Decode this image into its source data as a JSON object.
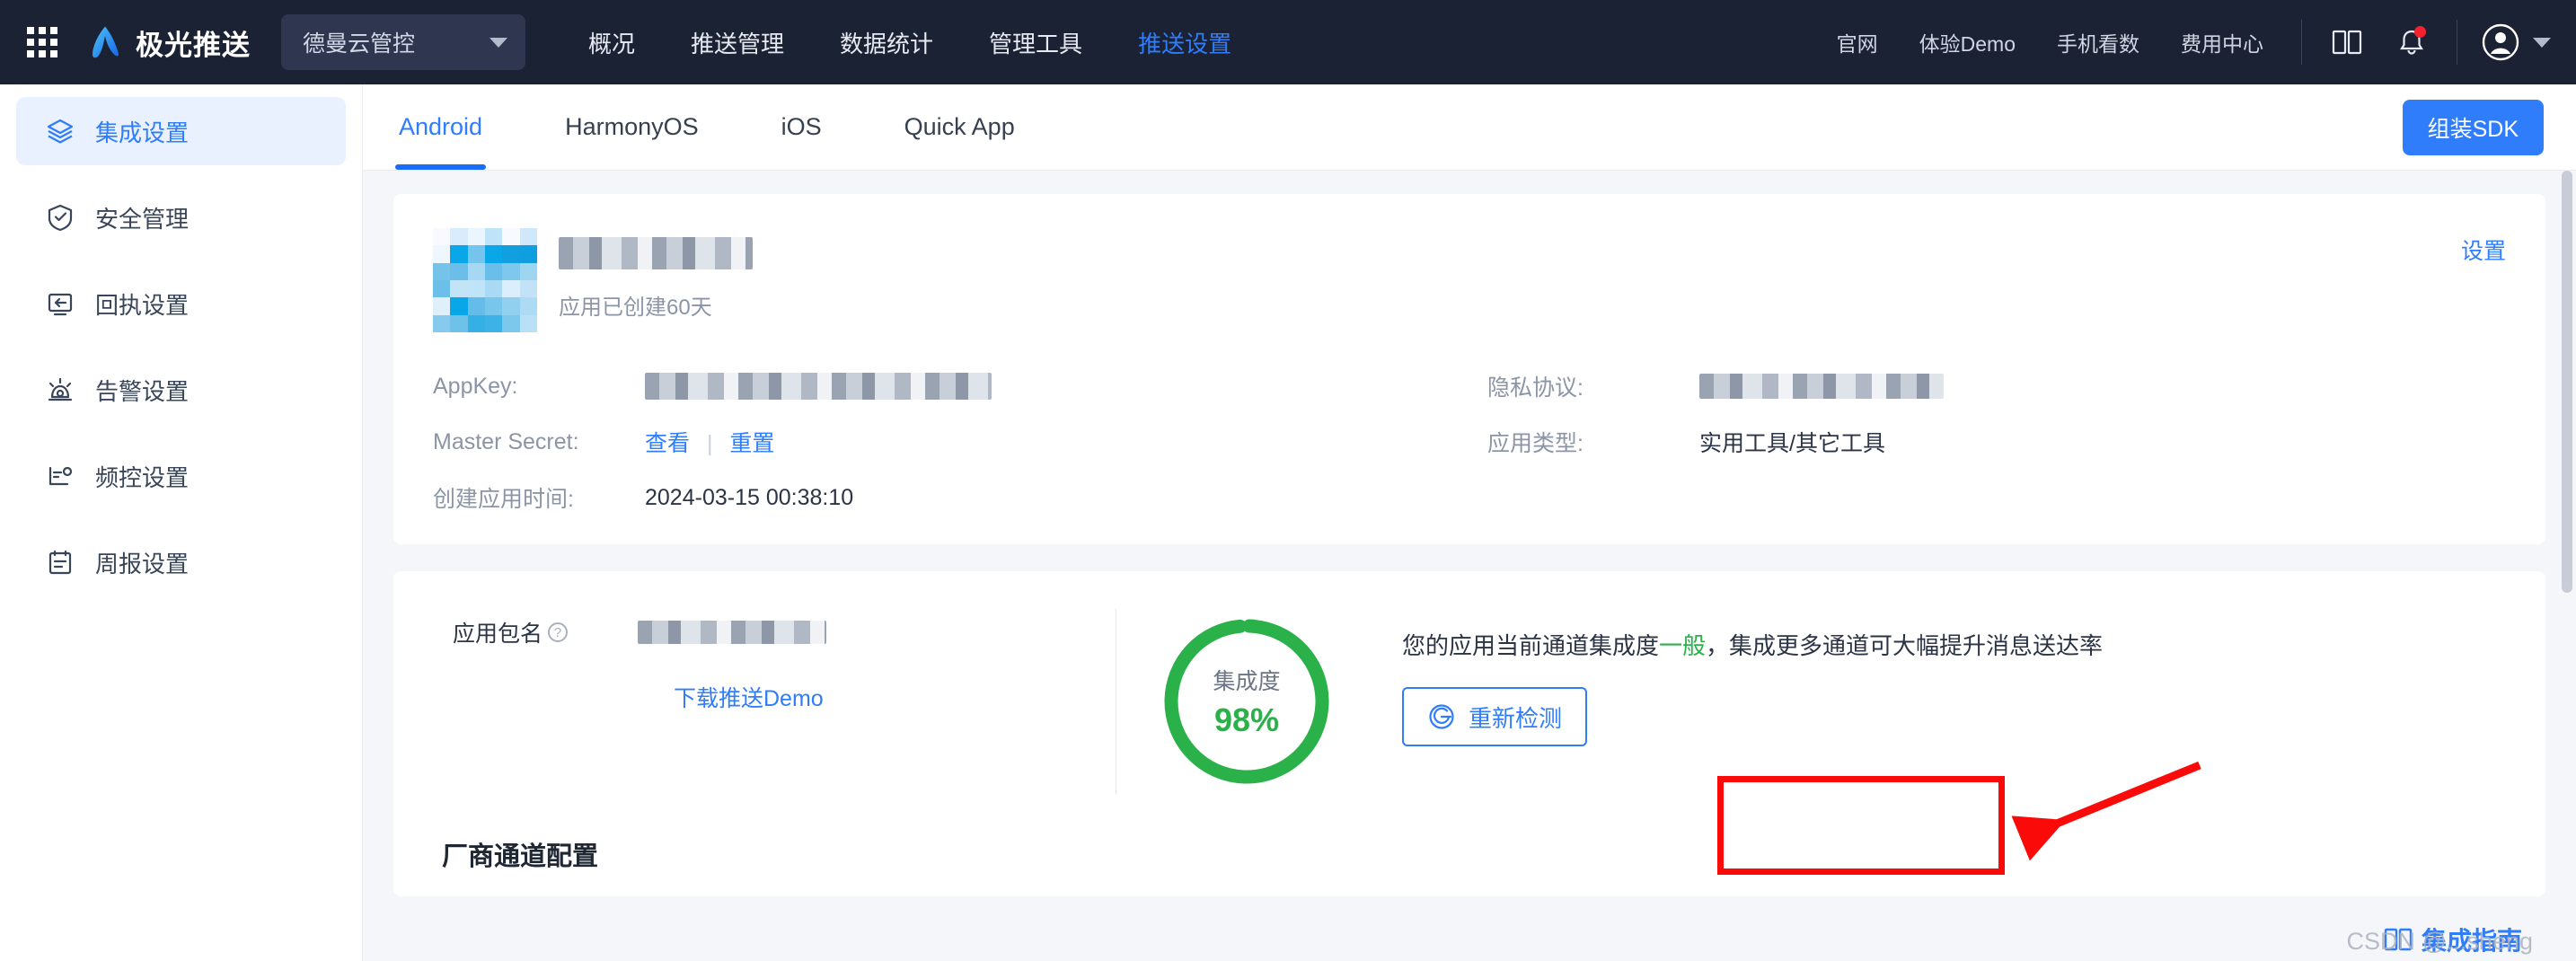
{
  "header": {
    "grid_icon": "apps-grid-icon",
    "brand": "极光推送",
    "app_selector": {
      "value": "德曼云管控",
      "icon": "chevron-down-icon"
    },
    "main_nav": [
      {
        "label": "概况",
        "active": false
      },
      {
        "label": "推送管理",
        "active": false
      },
      {
        "label": "数据统计",
        "active": false
      },
      {
        "label": "管理工具",
        "active": false
      },
      {
        "label": "推送设置",
        "active": true
      }
    ],
    "util_nav": [
      "官网",
      "体验Demo",
      "手机看数",
      "费用中心"
    ],
    "icons": [
      "book-icon",
      "bell-icon",
      "avatar-icon",
      "chevron-down-icon"
    ],
    "notification_badge": true
  },
  "sidebar": {
    "items": [
      {
        "label": "集成设置",
        "icon": "layers-icon",
        "active": true
      },
      {
        "label": "安全管理",
        "icon": "shield-check-icon",
        "active": false
      },
      {
        "label": "回执设置",
        "icon": "receipt-arrow-icon",
        "active": false
      },
      {
        "label": "告警设置",
        "icon": "alarm-icon",
        "active": false
      },
      {
        "label": "频控设置",
        "icon": "frequency-icon",
        "active": false
      },
      {
        "label": "周报设置",
        "icon": "report-icon",
        "active": false
      }
    ]
  },
  "tabs": [
    {
      "label": "Android",
      "active": true
    },
    {
      "label": "HarmonyOS",
      "active": false
    },
    {
      "label": "iOS",
      "active": false
    },
    {
      "label": "Quick App",
      "active": false
    }
  ],
  "toolbar": {
    "sdk_button": "组装SDK"
  },
  "app_card": {
    "app_name": "",
    "app_age": "应用已创建60天",
    "settings_link": "设置",
    "fields": [
      {
        "key": "AppKey:",
        "value": "",
        "masked": true
      },
      {
        "key": "隐私协议:",
        "value": "",
        "masked": true
      },
      {
        "key": "Master Secret:",
        "value": "",
        "links": [
          "查看",
          "重置"
        ]
      },
      {
        "key": "应用类型:",
        "value": "实用工具/其它工具"
      },
      {
        "key": "创建应用时间:",
        "value": "2024-03-15 00:38:10"
      }
    ]
  },
  "integration_card": {
    "package_label": "应用包名",
    "package_value": "",
    "help_icon": "question-circle-icon",
    "demo_link": "下载推送Demo",
    "ring": {
      "title": "集成度",
      "percent": "98%",
      "value": 98,
      "color": "#2bb14a"
    },
    "message_before": "您的应用当前通道集成度",
    "message_highlight": "一般",
    "message_after": "，集成更多通道可大幅提升消息送达率",
    "recheck_button": "重新检测",
    "recheck_icon": "refresh-detect-icon"
  },
  "section_title": "厂商通道配置",
  "guide": {
    "label": "集成指南",
    "icon": "book-icon"
  },
  "watermark": "CSDN @...sheng",
  "colors": {
    "header_bg": "#1b2233",
    "accent_blue": "#2f7dfb",
    "success_green": "#2bb14a",
    "annotation_red": "#fb0a0a",
    "page_bg": "#f4f6fa"
  }
}
